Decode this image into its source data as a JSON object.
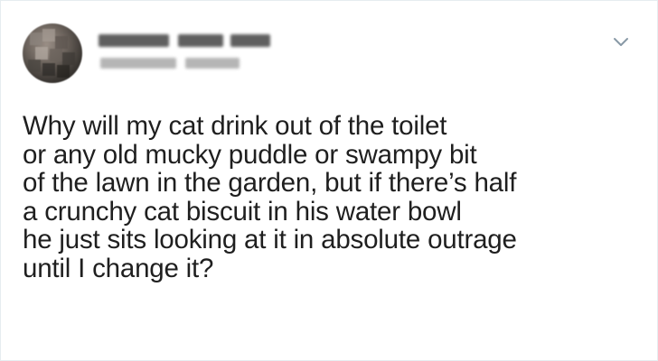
{
  "tweet": {
    "lines": [
      "Why will my cat drink out of the toilet",
      "or any old mucky puddle or swampy bit",
      "of the lawn in the garden, but if there’s half",
      "a crunchy cat biscuit in his water bowl",
      "he just sits looking at it in absolute outrage",
      "until I change it?"
    ]
  },
  "icons": {
    "menu": "chevron-down-icon"
  },
  "colors": {
    "text": "#1f1f1f",
    "border": "#e6ecf0",
    "chevron": "#8899a6"
  }
}
